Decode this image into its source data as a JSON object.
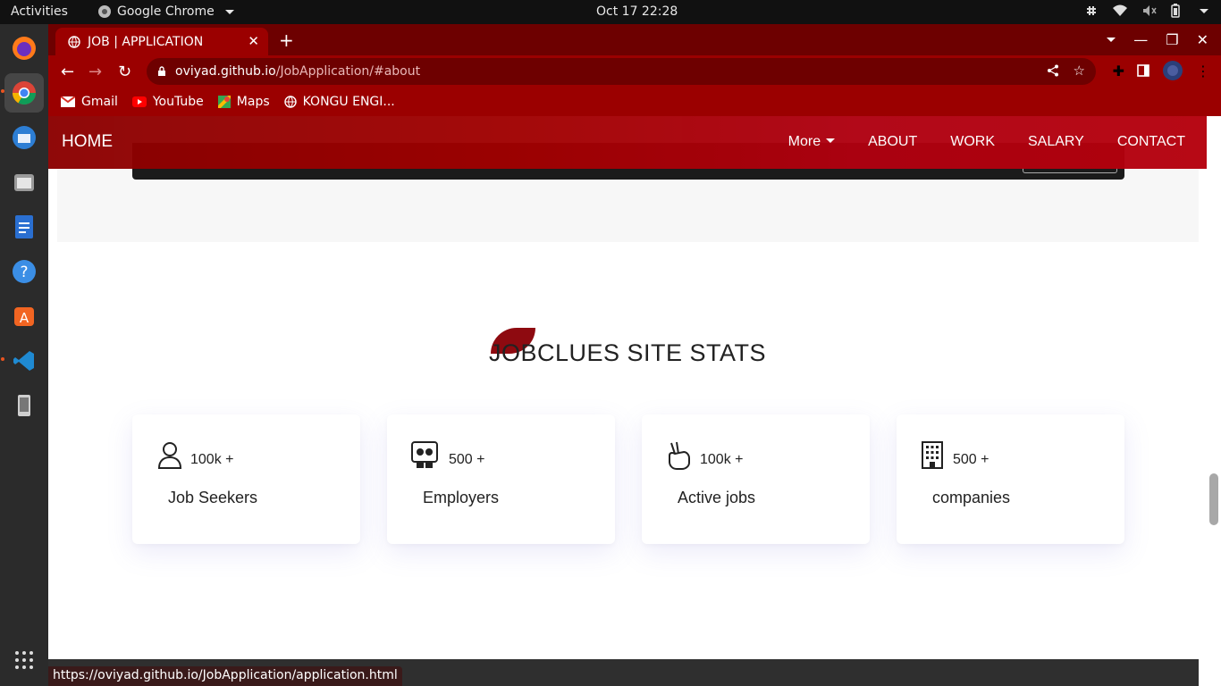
{
  "os": {
    "activities": "Activities",
    "app_menu": "Google Chrome",
    "clock": "Oct 17  22:28"
  },
  "browser": {
    "tab_title": "JOB | APPLICATION",
    "url_host": "oviyad.github.io",
    "url_path": "/JobApplication/#about",
    "bookmarks": [
      "Gmail",
      "YouTube",
      "Maps",
      "KONGU ENGI..."
    ],
    "status_url": "https://oviyad.github.io/JobApplication/application.html"
  },
  "nav": {
    "brand": "HOME",
    "more": "More",
    "items": [
      "ABOUT",
      "WORK",
      "SALARY",
      "CONTACT"
    ]
  },
  "stats": {
    "title": "JOBCLUES SITE STATS",
    "cards": [
      {
        "icon": "person-icon",
        "value": "100k +",
        "label": "Job Seekers"
      },
      {
        "icon": "employers-icon",
        "value": "500 +",
        "label": "Employers"
      },
      {
        "icon": "hand-peace-icon",
        "value": "100k +",
        "label": "Active jobs"
      },
      {
        "icon": "building-icon",
        "value": "500 +",
        "label": "companies"
      }
    ]
  },
  "colors": {
    "navbar": "#a00000",
    "accent": "#8e0a10",
    "toolbar": "#9b0000"
  }
}
